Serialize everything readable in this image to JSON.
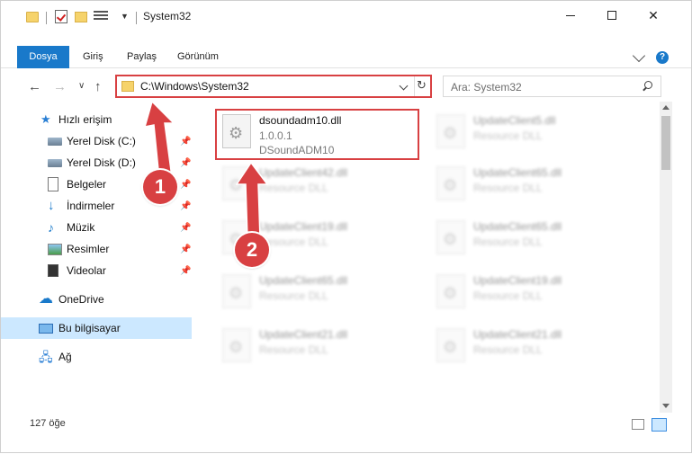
{
  "window": {
    "title": "System32"
  },
  "ribbon": {
    "tabs": [
      "Dosya",
      "Giriş",
      "Paylaş",
      "Görünüm"
    ]
  },
  "nav": {
    "address": "C:\\Windows\\System32",
    "search_placeholder": "Ara: System32"
  },
  "sidebar": {
    "items": [
      {
        "label": "Hızlı erişim",
        "icon": "star-icon"
      },
      {
        "label": "Yerel Disk (C:)",
        "icon": "drive-icon",
        "pinned": true
      },
      {
        "label": "Yerel Disk (D:)",
        "icon": "drive-icon",
        "pinned": true
      },
      {
        "label": "Belgeler",
        "icon": "documents-icon",
        "pinned": true
      },
      {
        "label": "İndirmeler",
        "icon": "download-icon",
        "pinned": true
      },
      {
        "label": "Müzik",
        "icon": "music-icon",
        "pinned": true
      },
      {
        "label": "Resimler",
        "icon": "pictures-icon",
        "pinned": true
      },
      {
        "label": "Videolar",
        "icon": "videos-icon",
        "pinned": true
      },
      {
        "label": "OneDrive",
        "icon": "cloud-icon"
      },
      {
        "label": "Bu bilgisayar",
        "icon": "computer-icon",
        "selected": true
      },
      {
        "label": "Ağ",
        "icon": "network-icon"
      }
    ]
  },
  "files": {
    "featured": {
      "name": "dsoundadm10.dll",
      "version": "1.0.0.1",
      "description": "DSoundADM10"
    },
    "left_column": [
      {
        "name": "UpdateClient42.dll",
        "type": "Resource DLL"
      },
      {
        "name": "UpdateClient19.dll",
        "type": "Resource DLL"
      },
      {
        "name": "UpdateClient65.dll",
        "type": "Resource DLL"
      },
      {
        "name": "UpdateClient21.dll",
        "type": "Resource DLL"
      }
    ],
    "right_column": [
      {
        "name": "UpdateClient5.dll",
        "type": "Resource DLL"
      },
      {
        "name": "UpdateClient65.dll",
        "type": "Resource DLL"
      },
      {
        "name": "UpdateClient65.dll",
        "type": "Resource DLL"
      },
      {
        "name": "UpdateClient19.dll",
        "type": "Resource DLL"
      },
      {
        "name": "UpdateClient21.dll",
        "type": "Resource DLL"
      }
    ]
  },
  "markers": [
    "1",
    "2"
  ],
  "status": {
    "item_count": "127 öğe"
  },
  "colors": {
    "accent": "#1979ca",
    "annotation": "#d84042",
    "selection": "#cce8ff"
  }
}
